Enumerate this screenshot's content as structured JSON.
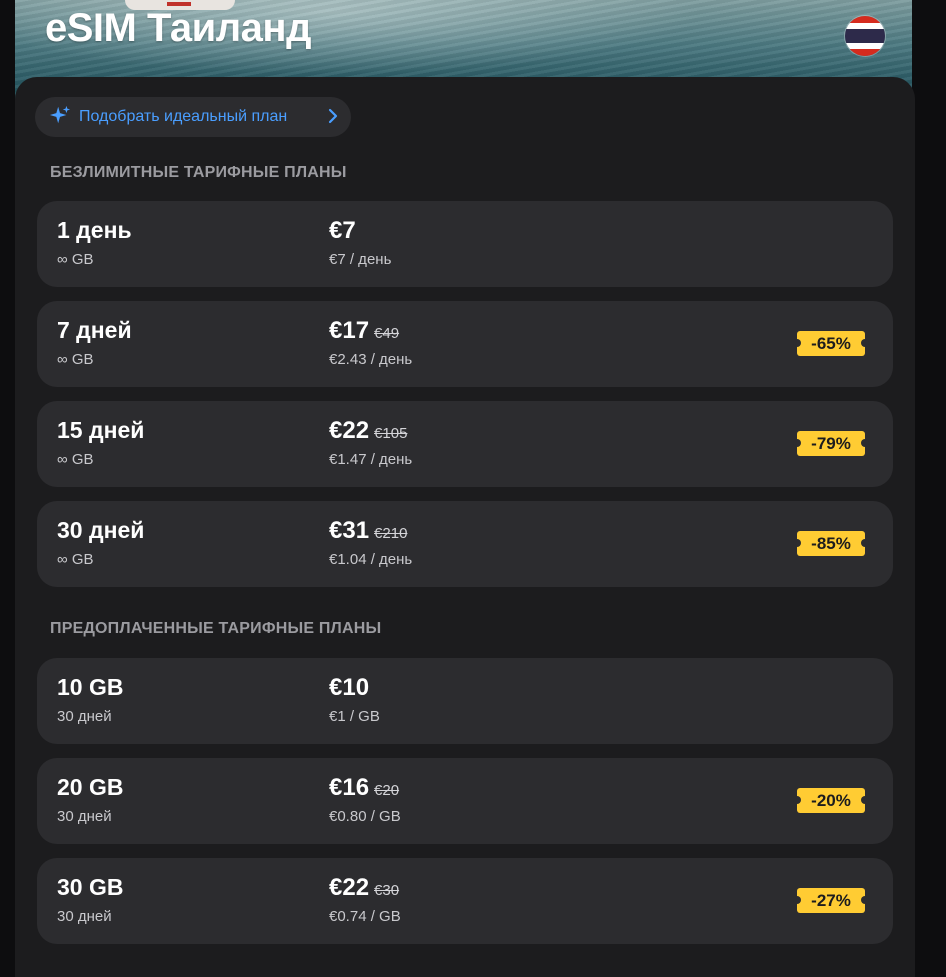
{
  "header": {
    "title": "eSIM Таиланд"
  },
  "pick_plan": {
    "label": "Подобрать идеальный план"
  },
  "sections": [
    {
      "title": "БЕЗЛИМИТНЫЕ ТАРИФНЫЕ ПЛАНЫ",
      "plans": [
        {
          "name": "1 день",
          "sub": "∞ GB",
          "price": "€7",
          "old_price": "",
          "unit_price": "€7 / день",
          "discount": ""
        },
        {
          "name": "7 дней",
          "sub": "∞ GB",
          "price": "€17",
          "old_price": "€49",
          "unit_price": "€2.43 / день",
          "discount": "-65%"
        },
        {
          "name": "15 дней",
          "sub": "∞ GB",
          "price": "€22",
          "old_price": "€105",
          "unit_price": "€1.47 / день",
          "discount": "-79%"
        },
        {
          "name": "30 дней",
          "sub": "∞ GB",
          "price": "€31",
          "old_price": "€210",
          "unit_price": "€1.04 / день",
          "discount": "-85%"
        }
      ]
    },
    {
      "title": "ПРЕДОПЛАЧЕННЫЕ ТАРИФНЫЕ ПЛАНЫ",
      "plans": [
        {
          "name": "10 GB",
          "sub": "30 дней",
          "price": "€10",
          "old_price": "",
          "unit_price": "€1 / GB",
          "discount": ""
        },
        {
          "name": "20 GB",
          "sub": "30 дней",
          "price": "€16",
          "old_price": "€20",
          "unit_price": "€0.80 / GB",
          "discount": "-20%"
        },
        {
          "name": "30 GB",
          "sub": "30 дней",
          "price": "€22",
          "old_price": "€30",
          "unit_price": "€0.74 / GB",
          "discount": "-27%"
        }
      ]
    }
  ],
  "colors": {
    "accent": "#4a9eff",
    "badge": "#ffcc33",
    "card": "#2c2c2f",
    "panel": "#1c1c1e"
  },
  "icons": {
    "pick_plan": "sparkle-icon",
    "chevron": "chevron-right-icon",
    "flag": "thailand-flag-icon"
  }
}
